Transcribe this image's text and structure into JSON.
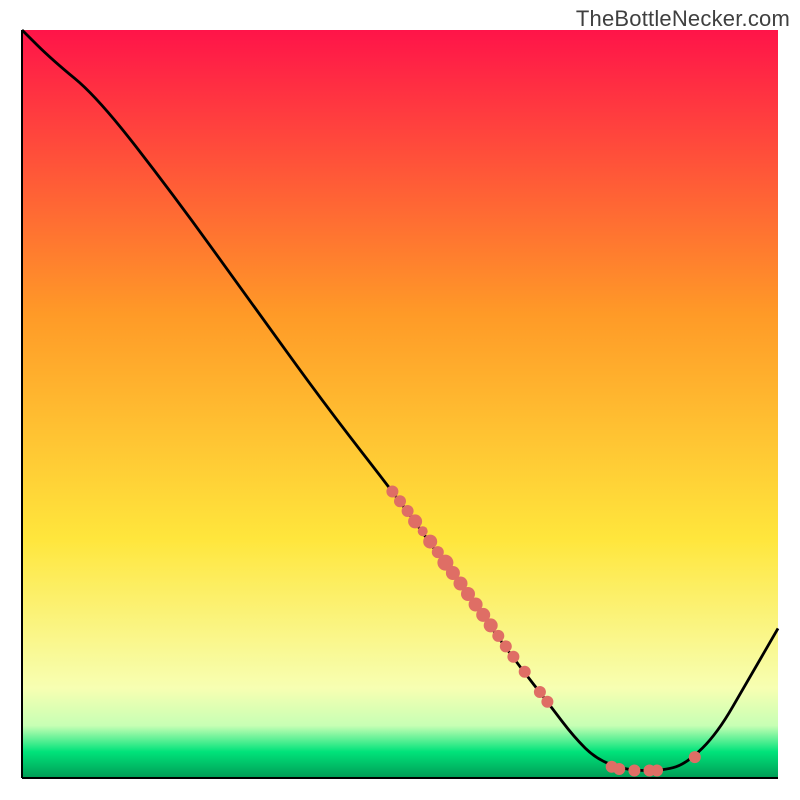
{
  "attribution": "TheBottleNecker.com",
  "chart_data": {
    "type": "line",
    "title": "",
    "xlabel": "",
    "ylabel": "",
    "xlim": [
      0,
      100
    ],
    "ylim": [
      0,
      100
    ],
    "grid": false,
    "curve": [
      {
        "x": 0.0,
        "y": 100.0
      },
      {
        "x": 4.0,
        "y": 96.0
      },
      {
        "x": 10.0,
        "y": 91.0
      },
      {
        "x": 20.0,
        "y": 78.0
      },
      {
        "x": 30.0,
        "y": 64.0
      },
      {
        "x": 40.0,
        "y": 50.0
      },
      {
        "x": 50.0,
        "y": 37.0
      },
      {
        "x": 55.0,
        "y": 30.0
      },
      {
        "x": 60.0,
        "y": 23.0
      },
      {
        "x": 65.0,
        "y": 16.0
      },
      {
        "x": 70.0,
        "y": 9.5
      },
      {
        "x": 73.0,
        "y": 5.5
      },
      {
        "x": 76.0,
        "y": 2.5
      },
      {
        "x": 80.0,
        "y": 1.0
      },
      {
        "x": 85.0,
        "y": 1.0
      },
      {
        "x": 88.0,
        "y": 2.0
      },
      {
        "x": 92.0,
        "y": 6.0
      },
      {
        "x": 96.0,
        "y": 13.0
      },
      {
        "x": 100.0,
        "y": 20.0
      }
    ],
    "markers": [
      {
        "x": 49.0,
        "y": 38.3,
        "r": 6
      },
      {
        "x": 50.0,
        "y": 37.0,
        "r": 6
      },
      {
        "x": 51.0,
        "y": 35.7,
        "r": 6
      },
      {
        "x": 52.0,
        "y": 34.3,
        "r": 7
      },
      {
        "x": 53.0,
        "y": 33.0,
        "r": 5
      },
      {
        "x": 54.0,
        "y": 31.6,
        "r": 7
      },
      {
        "x": 55.0,
        "y": 30.2,
        "r": 6
      },
      {
        "x": 56.0,
        "y": 28.8,
        "r": 8
      },
      {
        "x": 57.0,
        "y": 27.4,
        "r": 7
      },
      {
        "x": 58.0,
        "y": 26.0,
        "r": 7
      },
      {
        "x": 59.0,
        "y": 24.6,
        "r": 7
      },
      {
        "x": 60.0,
        "y": 23.2,
        "r": 7
      },
      {
        "x": 61.0,
        "y": 21.8,
        "r": 7
      },
      {
        "x": 62.0,
        "y": 20.4,
        "r": 7
      },
      {
        "x": 63.0,
        "y": 19.0,
        "r": 6
      },
      {
        "x": 64.0,
        "y": 17.6,
        "r": 6
      },
      {
        "x": 65.0,
        "y": 16.2,
        "r": 6
      },
      {
        "x": 66.5,
        "y": 14.2,
        "r": 6
      },
      {
        "x": 68.5,
        "y": 11.5,
        "r": 6
      },
      {
        "x": 69.5,
        "y": 10.2,
        "r": 6
      },
      {
        "x": 78.0,
        "y": 1.5,
        "r": 6
      },
      {
        "x": 79.0,
        "y": 1.2,
        "r": 6
      },
      {
        "x": 81.0,
        "y": 1.0,
        "r": 6
      },
      {
        "x": 83.0,
        "y": 1.0,
        "r": 6
      },
      {
        "x": 84.0,
        "y": 1.0,
        "r": 6
      },
      {
        "x": 89.0,
        "y": 2.8,
        "r": 6
      }
    ],
    "colors": {
      "marker_fill": "#df6e65",
      "curve_stroke": "#000000",
      "gradient_top": "#ff1449",
      "gradient_mid_upper": "#ff9a27",
      "gradient_mid_lower": "#ffe63c",
      "gradient_bottom_upper": "#f7ffb2",
      "gradient_bottom_band": "#00e37a",
      "gradient_base": "#009b55"
    }
  }
}
